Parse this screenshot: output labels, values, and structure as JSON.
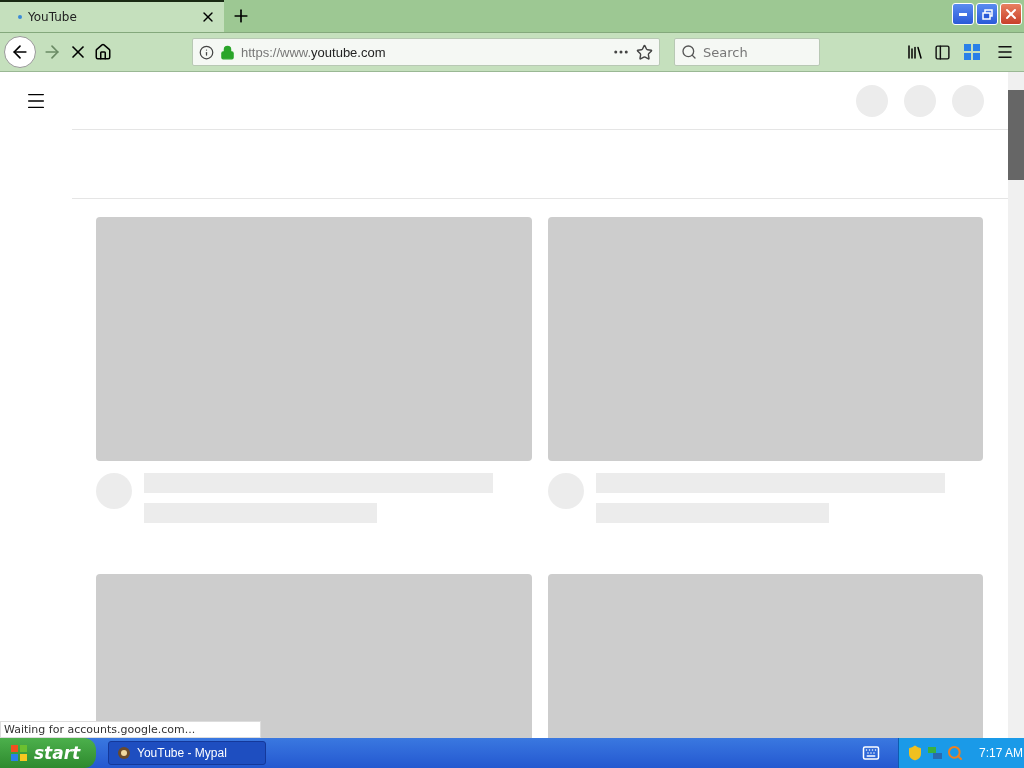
{
  "browser": {
    "tab": {
      "title": "YouTube"
    },
    "url": {
      "scheme": "https://www.",
      "host": "youtube.com"
    },
    "search": {
      "placeholder": "Search"
    }
  },
  "status_text": "Waiting for accounts.google.com...",
  "taskbar": {
    "start": "start",
    "task": "YouTube - Mypal",
    "clock": "7:17 AM"
  }
}
